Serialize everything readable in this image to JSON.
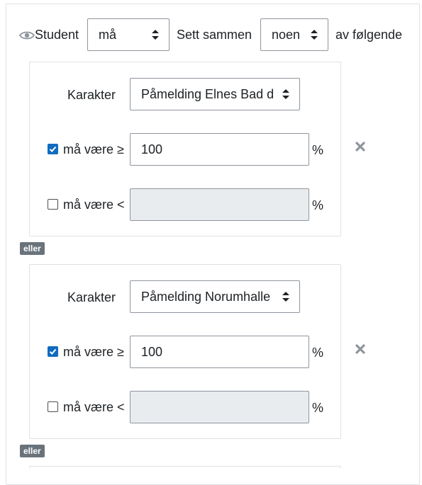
{
  "header": {
    "audience_label": "Student",
    "restriction_select": "må",
    "combine_label": "Sett sammen",
    "combine_select": "noen",
    "suffix_label": "av følgende"
  },
  "conditions": [
    {
      "field_label": "Karakter",
      "grade_item": "Påmelding Elnes Bad d",
      "min_checked": true,
      "min_label": "må være ≥",
      "min_value": "100",
      "min_unit": "%",
      "max_checked": false,
      "max_label": "må være <",
      "max_value": "",
      "max_unit": "%"
    },
    {
      "field_label": "Karakter",
      "grade_item": "Påmelding Norumhalle",
      "min_checked": true,
      "min_label": "må være ≥",
      "min_value": "100",
      "min_unit": "%",
      "max_checked": false,
      "max_label": "må være <",
      "max_value": "",
      "max_unit": "%"
    }
  ],
  "separators": [
    "eller",
    "eller"
  ],
  "icons": {
    "visibility": "eye-icon",
    "delete": "close-icon",
    "select_caret": "caret-updown-icon",
    "checked": "checkmark-icon"
  },
  "colors": {
    "checkbox_accent": "#0f6cbf",
    "badge_bg": "#6a737b",
    "disabled_bg": "#e9ecef"
  }
}
